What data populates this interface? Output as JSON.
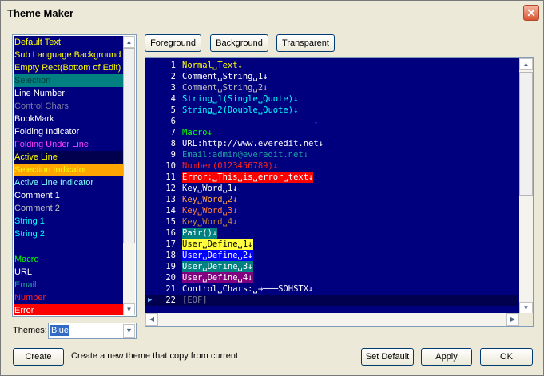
{
  "window": {
    "title": "Theme Maker",
    "close_label": "✕"
  },
  "list": {
    "items": [
      {
        "label": "Default Text",
        "color": "#ffff00",
        "bg": "#00007f",
        "selected": true
      },
      {
        "label": "Sub Language Background",
        "color": "#ffff00",
        "bg": "#00007f"
      },
      {
        "label": "Empty Rect(Bottom of Edit)",
        "color": "#ffff00",
        "bg": "#00007f"
      },
      {
        "label": "Selection",
        "color": "#003f3f",
        "bg": "#008080"
      },
      {
        "label": "Line Number",
        "color": "#ffffff",
        "bg": "#00007f"
      },
      {
        "label": "Control Chars",
        "color": "#7f7f9f",
        "bg": "#00007f"
      },
      {
        "label": "BookMark",
        "color": "#ffffff",
        "bg": "#00007f"
      },
      {
        "label": "Folding Indicator",
        "color": "#ffffff",
        "bg": "#00007f"
      },
      {
        "label": "Folding Under Line",
        "color": "#ff40ff",
        "bg": "#00007f"
      },
      {
        "label": "Active Line",
        "color": "#ffff00",
        "bg": "#00004f"
      },
      {
        "label": "Selection Indicator",
        "color": "#ffff00",
        "bg": "#ffa500"
      },
      {
        "label": "Active Line Indicator",
        "color": "#80ffff",
        "bg": "#00007f"
      },
      {
        "label": "Comment 1",
        "color": "#ffffff",
        "bg": "#00007f"
      },
      {
        "label": "Comment 2",
        "color": "#c0c0c0",
        "bg": "#00007f"
      },
      {
        "label": "String 1",
        "color": "#00ffff",
        "bg": "#00007f"
      },
      {
        "label": "String 2",
        "color": "#00ffff",
        "bg": "#00007f"
      },
      {
        "label": "",
        "color": "#0000ff",
        "bg": "#00007f"
      },
      {
        "label": "Macro",
        "color": "#00ff00",
        "bg": "#00007f"
      },
      {
        "label": "URL",
        "color": "#ffffff",
        "bg": "#00007f"
      },
      {
        "label": "Email",
        "color": "#20a0a0",
        "bg": "#00007f"
      },
      {
        "label": "Number",
        "color": "#ff2020",
        "bg": "#00007f"
      },
      {
        "label": "Error",
        "color": "#ffffff",
        "bg": "#ff0000"
      }
    ]
  },
  "themes": {
    "label": "Themes:",
    "value": "Blue"
  },
  "toolbar": {
    "foreground": "Foreground",
    "background": "Background",
    "transparent": "Transparent"
  },
  "editor": {
    "lines": [
      {
        "n": "1",
        "text": "Normal␣Text↓",
        "color": "#ffff00",
        "bg": ""
      },
      {
        "n": "2",
        "text": "Comment␣String␣1↓",
        "color": "#ffffff",
        "bg": ""
      },
      {
        "n": "3",
        "text": "Comment␣String␣2↓",
        "color": "#c0c0c0",
        "bg": ""
      },
      {
        "n": "4",
        "text": "String␣1(Single␣Quote)↓",
        "color": "#00ffff",
        "bg": ""
      },
      {
        "n": "5",
        "text": "String␣2(Double␣Quote)↓",
        "color": "#00ffff",
        "bg": ""
      },
      {
        "n": "6",
        "text": "                          ↓",
        "color": "#3030ff",
        "bg": ""
      },
      {
        "n": "7",
        "text": "Macro↓",
        "color": "#00ff00",
        "bg": ""
      },
      {
        "n": "8",
        "text": "URL:http://www.everedit.net↓",
        "color": "#ffffff",
        "bg": ""
      },
      {
        "n": "9",
        "text": "Email:admin@everedit.net↓",
        "color": "#20a0a0",
        "bg": ""
      },
      {
        "n": "10",
        "text": "Number(0123456789)↓",
        "color": "#ff2020",
        "bg": ""
      },
      {
        "n": "11",
        "text": "Error:␣This␣is␣error␣text↓",
        "color": "#ffffff",
        "bg": "#ff0000"
      },
      {
        "n": "12",
        "text": "Key␣Word␣1↓",
        "color": "#ffffff",
        "bg": ""
      },
      {
        "n": "13",
        "text": "Key␣Word␣2↓",
        "color": "#ffa040",
        "bg": ""
      },
      {
        "n": "14",
        "text": "Key␣Word␣3↓",
        "color": "#ff8040",
        "bg": ""
      },
      {
        "n": "15",
        "text": "Key␣Word␣4↓",
        "color": "#c08040",
        "bg": ""
      },
      {
        "n": "16",
        "text": "Pair()↓",
        "color": "#ffffff",
        "bg": "#008080"
      },
      {
        "n": "17",
        "text": "User␣Define␣1↓",
        "color": "#000000",
        "bg": "#ffff40"
      },
      {
        "n": "18",
        "text": "User␣Define␣2↓",
        "color": "#ffffff",
        "bg": "#0000ff"
      },
      {
        "n": "19",
        "text": "User␣Define␣3↓",
        "color": "#ffffff",
        "bg": "#008080"
      },
      {
        "n": "20",
        "text": "User␣Define␣4↓",
        "color": "#ffffff",
        "bg": "#800080"
      },
      {
        "n": "21",
        "text": "Control␣Chars:␣→───SOHSTX↓",
        "color": "#ffffff",
        "bg": ""
      },
      {
        "n": "22",
        "text": "[EOF]",
        "color": "#7f7f9f",
        "bg": ""
      }
    ]
  },
  "bottom": {
    "create": "Create",
    "hint": "Create a new theme that copy from current",
    "set_default": "Set Default",
    "apply": "Apply",
    "ok": "OK"
  }
}
